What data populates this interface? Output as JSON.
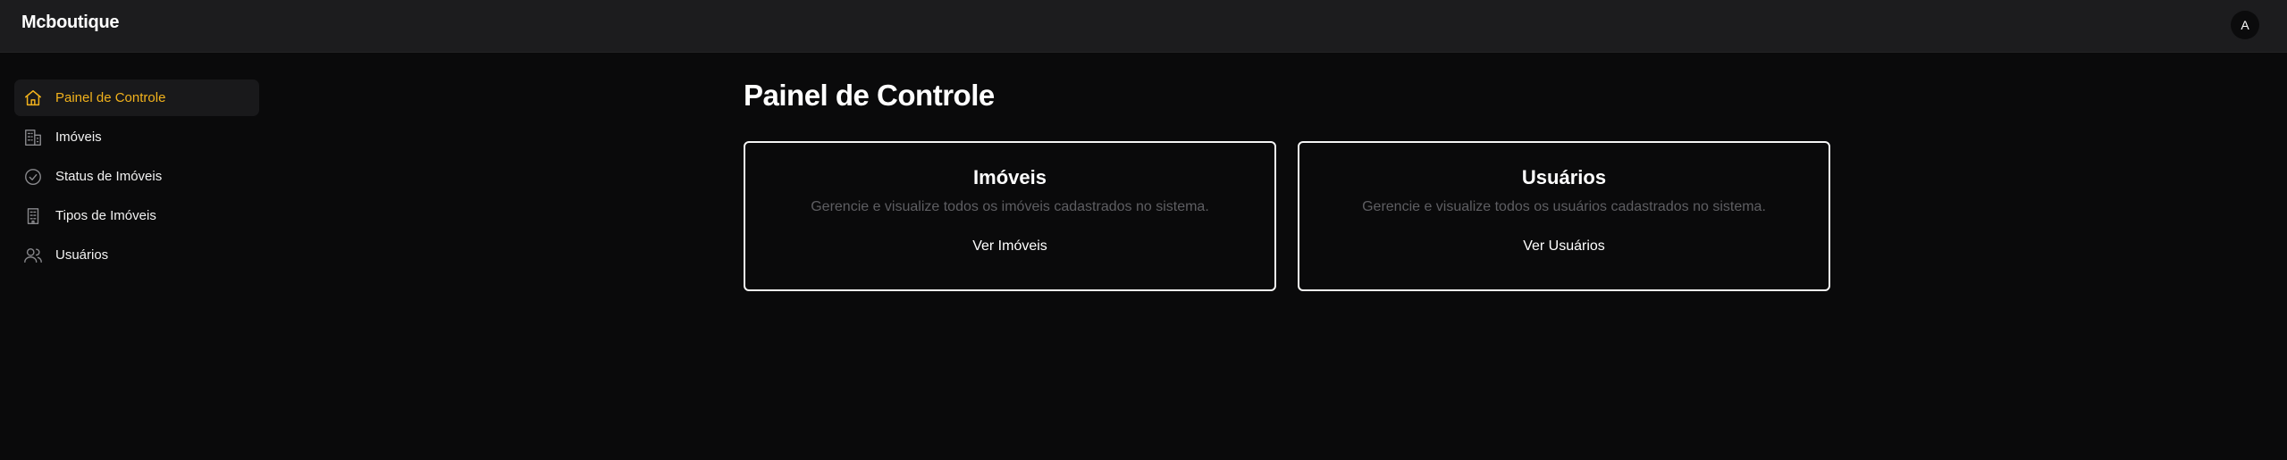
{
  "header": {
    "brand": "Mcboutique",
    "avatar_initial": "A"
  },
  "sidebar": {
    "items": [
      {
        "label": "Painel de Controle",
        "icon": "home-icon",
        "active": true
      },
      {
        "label": "Imóveis",
        "icon": "building-icon",
        "active": false
      },
      {
        "label": "Status de Imóveis",
        "icon": "check-circle-icon",
        "active": false
      },
      {
        "label": "Tipos de Imóveis",
        "icon": "building-tall-icon",
        "active": false
      },
      {
        "label": "Usuários",
        "icon": "users-icon",
        "active": false
      }
    ]
  },
  "main": {
    "title": "Painel de Controle",
    "cards": [
      {
        "title": "Imóveis",
        "description": "Gerencie e visualize todos os imóveis cadastrados no sistema.",
        "link_label": "Ver Imóveis"
      },
      {
        "title": "Usuários",
        "description": "Gerencie e visualize todos os usuários cadastrados no sistema.",
        "link_label": "Ver Usuários"
      }
    ]
  },
  "colors": {
    "accent": "#f2b21c",
    "background": "#0a0a0b",
    "topbar": "#1c1c1e",
    "muted_text": "#5e5e62"
  }
}
